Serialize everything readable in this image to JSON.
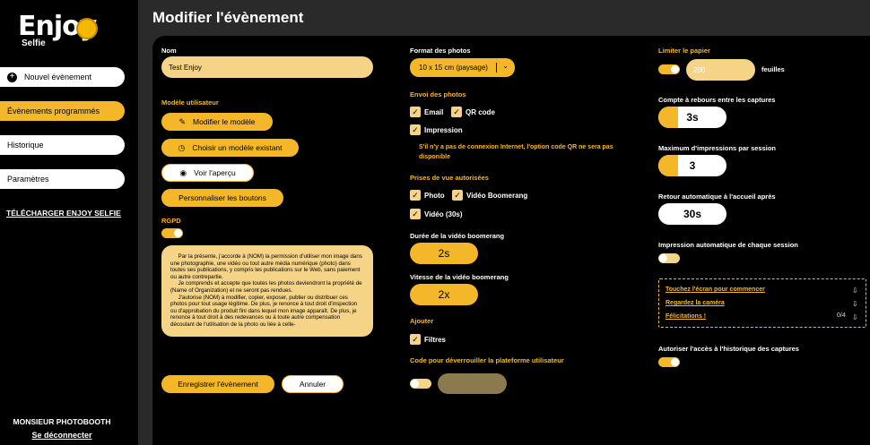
{
  "logo": {
    "main": "Enjoy",
    "sub": "Selfie"
  },
  "sidebar": {
    "items": [
      {
        "label": "Nouvel évènement"
      },
      {
        "label": "Évènements programmés"
      },
      {
        "label": "Historique"
      },
      {
        "label": "Paramètres"
      }
    ],
    "download": "TÉLÉCHARGER ENJOY SELFIE",
    "user": "MONSIEUR PHOTOBOOTH",
    "logout": "Se déconnecter"
  },
  "page_title": "Modifier l'évènement",
  "col1": {
    "name_label": "Nom",
    "name_value": "Test Enjoy",
    "model_label": "Modèle utilisateur",
    "modify_model": "Modifier le modèle",
    "choose_model": "Choisir un modèle existant",
    "preview": "Voir l'aperçu",
    "customize_buttons": "Personnaliser les boutons",
    "rgpd_label": "RGPD",
    "rgpd_text": "     Par la présente, j'accorde à (NOM) la permission d'utiliser mon image dans une photographie, une vidéo ou tout autre média numérique (photo) dans toutes ses publications, y compris les publications sur le Web, sans paiement ou autre contrepartie.\n     Je comprends et accepte que toutes les photos deviendront la propriété de (Name of Organization) et ne seront pas rendues.\n     J'autorise (NOM) à modifier, copier, exposer, publier ou distribuer ces photos pour tout usage légitime. De plus, je renonce à tout droit d'inspection ou d'approbation du produit fini dans lequel mon image apparaît. De plus, je renonce à tout droit à des redevances ou à toute autre compensation découlant de l'utilisation de la photo ou liée à celle-",
    "save": "Enregistrer l'évènement",
    "cancel": "Annuler"
  },
  "col2": {
    "format_label": "Format des photos",
    "format_value": "10 x 15 cm (paysage)",
    "send_label": "Envoi des photos",
    "email": "Email",
    "qrcode": "QR code",
    "print": "Impression",
    "note": "S'il n'y a pas de connexion Internet, l'option code QR ne sera pas disponible",
    "shots_label": "Prises de vue autorisées",
    "photo": "Photo",
    "boomerang": "Vidéo Boomerang",
    "video": "Vidéo (30s)",
    "boomerang_duration_label": "Durée de la vidéo boomerang",
    "boomerang_duration": "2s",
    "boomerang_speed_label": "Vitesse de la vidéo boomerang",
    "boomerang_speed": "2x",
    "add_label": "Ajouter",
    "filters": "Filtres",
    "unlock_label": "Code pour déverrouiller la plateforme utilisateur"
  },
  "col3": {
    "paper_label": "Limiter le papier",
    "paper_value": "200",
    "sheets": "feuilles",
    "countdown_label": "Compte à rebours entre les captures",
    "countdown": "3s",
    "max_prints_label": "Maximum d'impressions par session",
    "max_prints": "3",
    "auto_return_label": "Retour automatique à l'accueil après",
    "auto_return": "30s",
    "auto_print_label": "Impression automatique de chaque session",
    "touch": "Touchez l'écran pour commencer",
    "look": "Regardez la caméra",
    "congrats": "Félicitations !",
    "count": "0/4",
    "history_label": "Autoriser l'accès à l'historique des captures"
  },
  "colors": {
    "accent": "#f5b72a",
    "light_accent": "#f5d488",
    "panel": "#000000",
    "background": "#2a2a2a"
  },
  "icons": [
    "plus-icon",
    "pencil-icon",
    "history-icon",
    "eye-icon",
    "chevron-down-icon",
    "check-icon",
    "cloud-download-icon"
  ]
}
